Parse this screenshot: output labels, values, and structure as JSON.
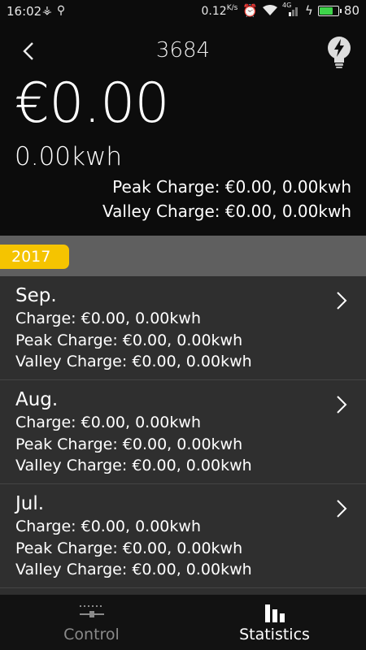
{
  "status_bar": {
    "time": "16:02",
    "left_icons": [
      "usb-debug-icon",
      "usb-icon"
    ],
    "speed": "0.12",
    "speed_unit": "K/s",
    "network_label": "4G",
    "battery_level": "80",
    "battery_fill_fraction": 0.8,
    "battery_color": "#3ed44a"
  },
  "header": {
    "device_id": "3684",
    "back_icon": "chevron-left-icon",
    "action_icon": "lightbulb-icon"
  },
  "summary": {
    "amount": "€0.00",
    "energy": "0.00kwh",
    "peak": "Peak Charge: €0.00, 0.00kwh",
    "valley": "Valley Charge: €0.00, 0.00kwh"
  },
  "year": {
    "label": "2017",
    "accent_color": "#f5c400"
  },
  "months": [
    {
      "name": "Sep.",
      "charge": "Charge: €0.00, 0.00kwh",
      "peak": "Peak Charge: €0.00, 0.00kwh",
      "valley": "Valley Charge: €0.00, 0.00kwh"
    },
    {
      "name": "Aug.",
      "charge": "Charge: €0.00, 0.00kwh",
      "peak": "Peak Charge: €0.00, 0.00kwh",
      "valley": "Valley Charge: €0.00, 0.00kwh"
    },
    {
      "name": "Jul.",
      "charge": "Charge: €0.00, 0.00kwh",
      "peak": "Peak Charge: €0.00, 0.00kwh",
      "valley": "Valley Charge: €0.00, 0.00kwh"
    }
  ],
  "nav": {
    "control_label": "Control",
    "statistics_label": "Statistics",
    "active_tab": "statistics"
  }
}
